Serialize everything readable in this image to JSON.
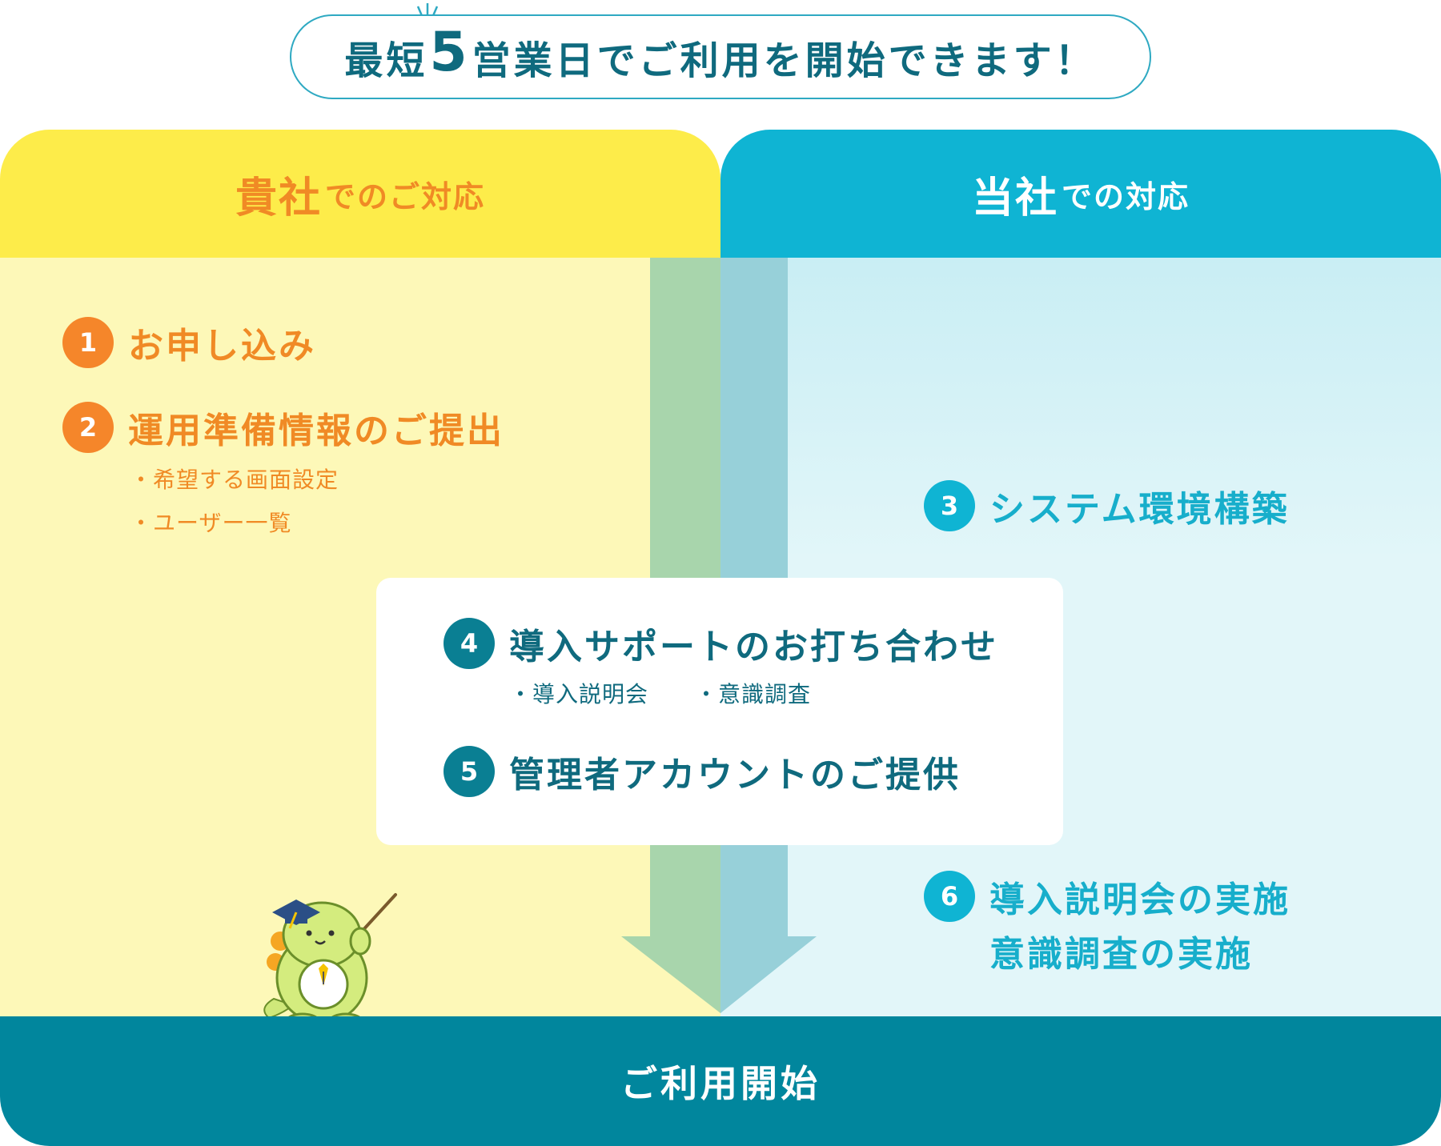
{
  "banner": {
    "prefix": "最短",
    "number": "5",
    "suffix": "営業日でご利用を開始できます！"
  },
  "headers": {
    "client": {
      "strong": "貴社",
      "rest": "でのご対応"
    },
    "vendor": {
      "strong": "当社",
      "rest": "での対応"
    }
  },
  "steps": [
    {
      "num": "1",
      "label": "お申し込み"
    },
    {
      "num": "2",
      "label": "運用準備情報のご提出",
      "subs": [
        "・希望する画面設定",
        "・ユーザー一覧"
      ]
    },
    {
      "num": "3",
      "label": "システム環境構築"
    },
    {
      "num": "4",
      "label": "導入サポートのお打ち合わせ",
      "subs": [
        "・導入説明会",
        "・意識調査"
      ]
    },
    {
      "num": "5",
      "label": "管理者アカウントのご提供"
    },
    {
      "num": "6",
      "lines": [
        "導入説明会の実施",
        "意識調査の実施"
      ]
    }
  ],
  "footer": {
    "label": "ご利用開始"
  },
  "colors": {
    "client_header": "#fdec4a",
    "client_body": "#fdf8b8",
    "client_text": "#f08a25",
    "vendor_header": "#0fb4d3",
    "vendor_body": "#e2f6f9",
    "vendor_text": "#17aecb",
    "shared_text": "#0f6a7e",
    "footer": "#01869d",
    "arrow_left": "#a8d5ac",
    "arrow_right": "#97d0d9"
  },
  "icons": {
    "mascot": "dinosaur-mascot-with-graduation-cap-and-pointer",
    "sparkle": "sparkle-icon"
  }
}
